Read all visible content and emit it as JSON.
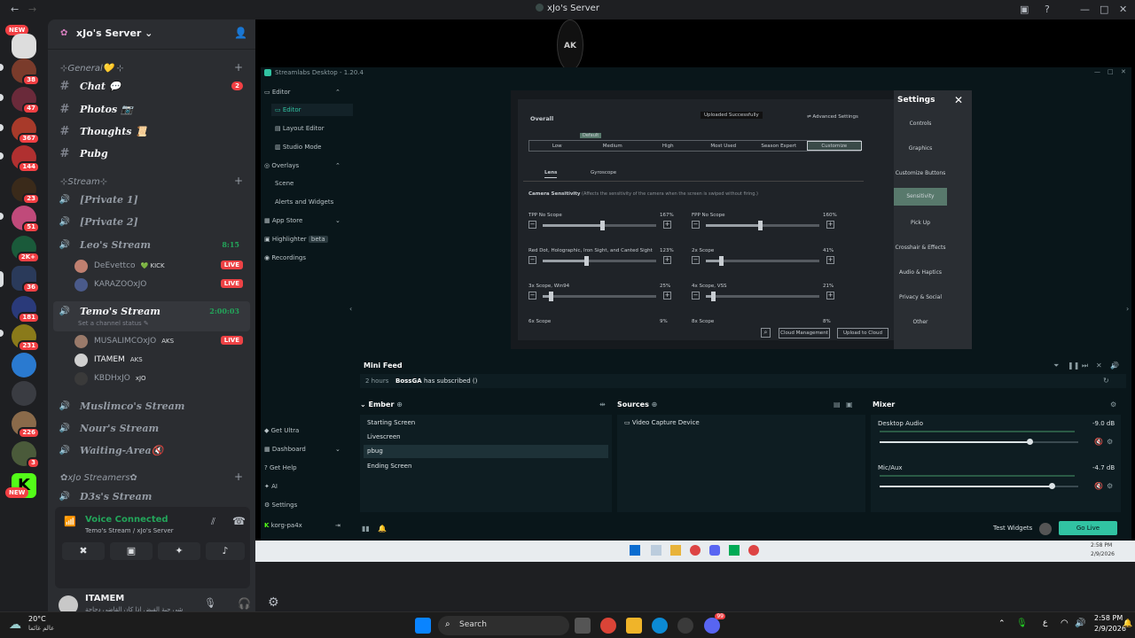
{
  "window": {
    "title": "xJo's Server"
  },
  "rail": {
    "new_top": "NEW",
    "new_bottom": "NEW",
    "badges": [
      "38",
      "47",
      "367",
      "144",
      "23",
      "51",
      "2K+",
      "36",
      "181",
      "231",
      "226",
      "3"
    ]
  },
  "server": {
    "name": "xJo's Server ⌄"
  },
  "categories": {
    "general": "⊹General💛 ⊹",
    "stream": "⊹Stream⊹",
    "streamers": "✿xJo Streamers✿"
  },
  "text_channels": [
    {
      "name": "Chat 💬",
      "badge": "2"
    },
    {
      "name": "Photos 📷"
    },
    {
      "name": "Thoughts 📜"
    },
    {
      "name": "Pubg"
    }
  ],
  "voice_channels": {
    "private1": "[Private 1]",
    "private2": "[Private 2]",
    "leo": {
      "name": "Leo's Stream",
      "timer": "8:15",
      "users": [
        {
          "name": "DeEvettco",
          "tag": "💚 KICK",
          "live": "LIVE"
        },
        {
          "name": "KARAZOOxJO",
          "live": "LIVE"
        }
      ]
    },
    "temo": {
      "name": "Temo's Stream",
      "timer": "2:00:03",
      "status": "Set a channel status ✎",
      "users": [
        {
          "name": "MUSALIMCOxJO",
          "tag": "AKS",
          "live": "LIVE"
        },
        {
          "name": "ITAMEM",
          "tag": "AKS"
        },
        {
          "name": "KBDHxJO",
          "tag": "xJO"
        }
      ]
    },
    "muslimco": "Muslimco's Stream",
    "nour": "Nour's Stream",
    "waiting": "Waiting-Area🔇",
    "d3s": "D3s's Stream"
  },
  "voice_panel": {
    "status": "Voice Connected",
    "channel": "Temo's Stream / xJo's Server"
  },
  "user": {
    "name": "ITAMEM",
    "status": "ﻣﺎﺷﻲ ﺣﺒﺔ ﺍﻟﻔﻴﺾ ﺍﺫﺍ ﻛﺎﻥ ﺍﻟﻘﺎﺿﻲ ﺩﺟﺎﺟﺔ..."
  },
  "streamlabs": {
    "title": "Streamlabs Desktop - 1.20.4",
    "nav": {
      "editor": "Editor",
      "editor_sub": "Editor",
      "layout": "Layout Editor",
      "studio": "Studio Mode",
      "overlays": "Overlays",
      "scene": "Scene",
      "alerts": "Alerts and Widgets",
      "appstore": "App Store",
      "highlighter": "Highlighter",
      "beta": "beta",
      "recordings": "Recordings",
      "ultra": "Get Ultra",
      "dashboard": "Dashboard",
      "help": "Get Help",
      "ai": "AI",
      "settings": "Settings",
      "account": "korg-pa4x"
    },
    "game": {
      "settings_title": "Settings",
      "menu": [
        "Controls",
        "Graphics",
        "Customize Buttons",
        "Sensitivity",
        "Pick Up",
        "Crosshair & Effects",
        "Audio & Haptics",
        "Privacy & Social",
        "Other"
      ],
      "overall": "Overall",
      "uploaded": "Uploaded Successfully",
      "advanced": "Advanced Settings",
      "default": "Default",
      "presets": [
        "Low",
        "Medium",
        "High",
        "Most Used",
        "Season Expert",
        "Customize"
      ],
      "tabs": [
        "Lens",
        "Gyroscope"
      ],
      "cam_sens": "Camera Sensitivity",
      "cam_desc": "(Affects the sensitivity of the camera when the screen is swiped without firing.)",
      "sliders": [
        {
          "label": "TPP No Scope",
          "value": "167%",
          "level": 0.52
        },
        {
          "label": "FPP No Scope",
          "value": "160%",
          "level": 0.48
        },
        {
          "label": "Red Dot, Holographic, Iron Sight, and Canted Sight",
          "value": "123%",
          "level": 0.38
        },
        {
          "label": "2x Scope",
          "value": "41%",
          "level": 0.13
        },
        {
          "label": "3x Scope, Win94",
          "value": "25%",
          "level": 0.07
        },
        {
          "label": "4x Scope, VSS",
          "value": "21%",
          "level": 0.06
        },
        {
          "label": "6x Scope",
          "value": "9%"
        },
        {
          "label": "8x Scope",
          "value": "8%"
        }
      ],
      "cloud_mgmt": "Cloud Management",
      "upload": "Upload to Cloud"
    },
    "minifeed": {
      "title": "Mini Feed",
      "time": "2 hours",
      "user": "BossGA",
      "text": "has subscribed ()"
    },
    "scenes": {
      "title": "Ember",
      "items": [
        "Starting Screen",
        "Livescreen",
        "pbug",
        "Ending Screen"
      ]
    },
    "sources": {
      "title": "Sources",
      "items": [
        "Video Capture Device"
      ]
    },
    "mixer": {
      "title": "Mixer",
      "items": [
        {
          "name": "Desktop Audio",
          "db": "-9.0 dB",
          "level": 0.76
        },
        {
          "name": "Mic/Aux",
          "db": "-4.7 dB",
          "level": 0.87
        }
      ]
    },
    "test_widgets": "Test Widgets",
    "golive": "Go Live"
  },
  "innerclock": {
    "time": "2:58 PM",
    "date": "2/9/2026"
  },
  "taskbar": {
    "weather": "20°C",
    "weather_sub": "عالم غائما",
    "search": "Search",
    "lang": "ع",
    "time": "2:58 PM",
    "date": "2/9/2026",
    "discord_badge": "99"
  }
}
